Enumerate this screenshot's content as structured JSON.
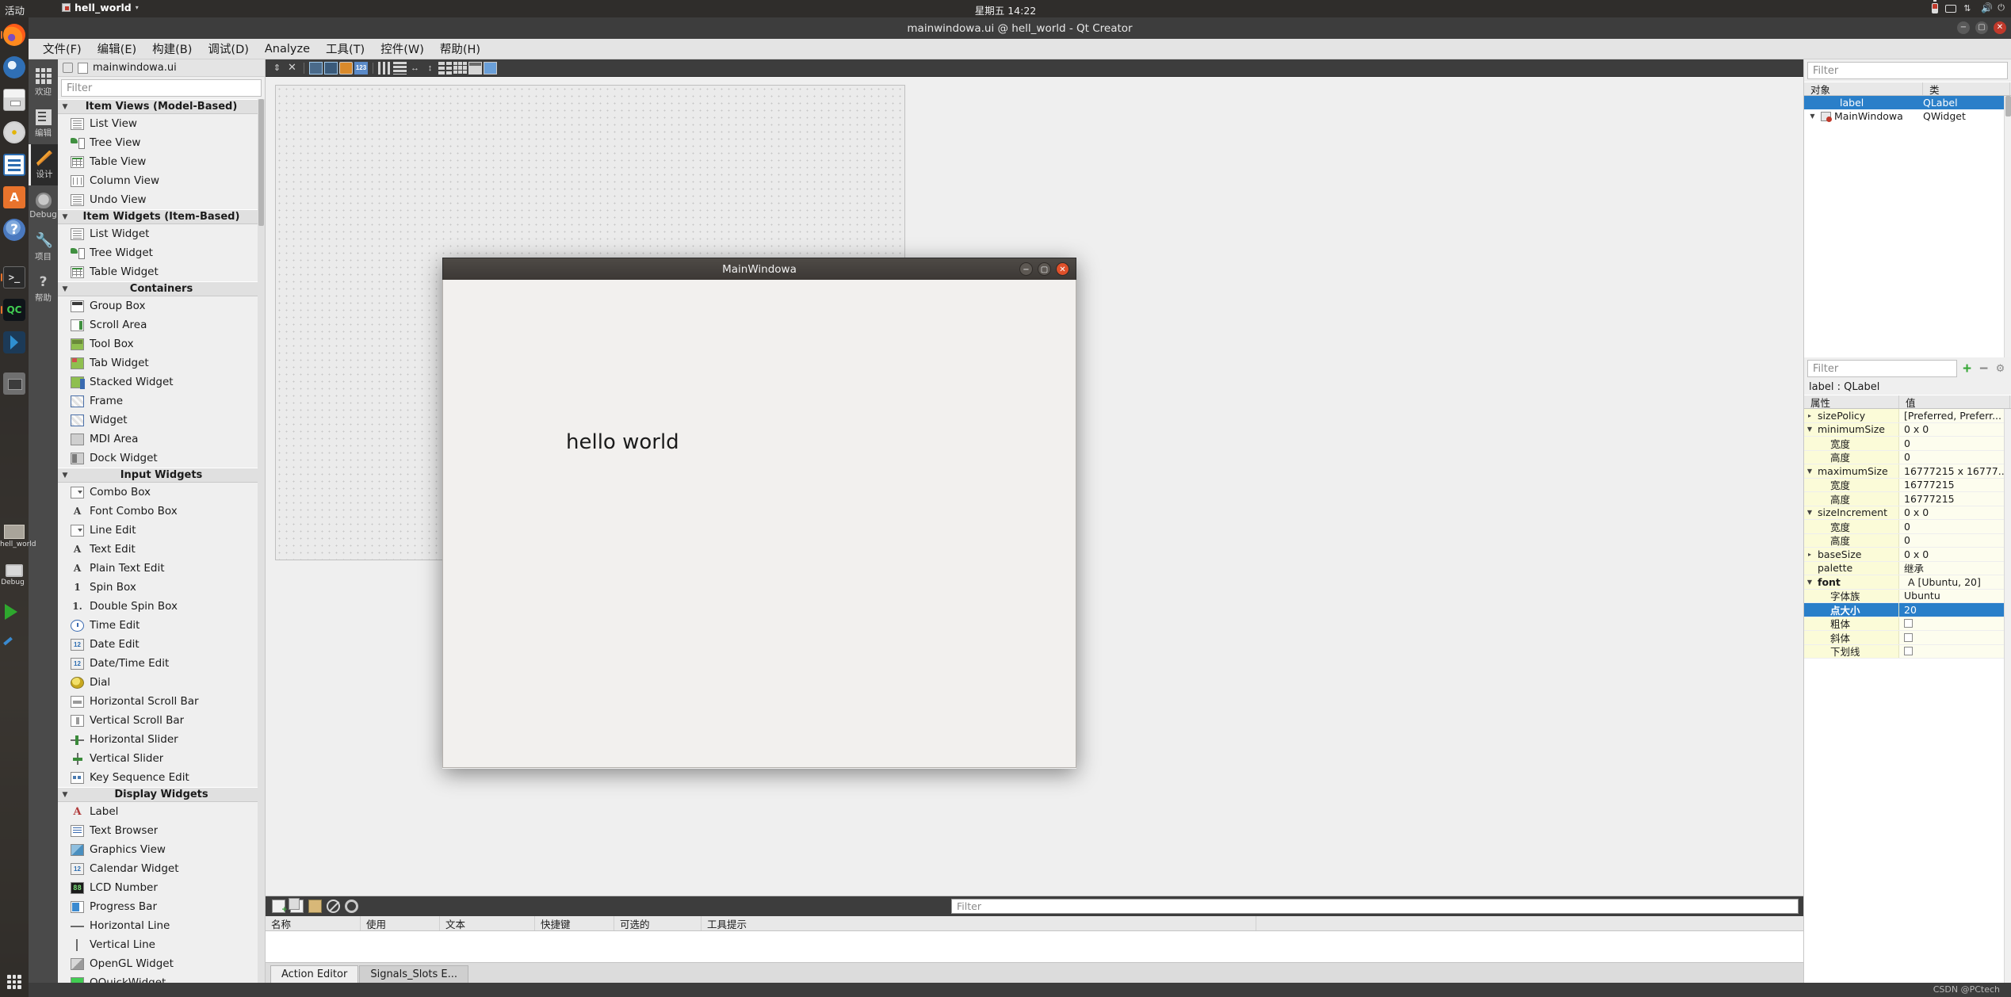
{
  "desktop": {
    "topbar": {
      "activities": "活动",
      "app_name": "hell_world",
      "clock": "星期五 14:22",
      "tray_icons": [
        "battery-icon",
        "keyboard-icon",
        "network-icon",
        "volume-icon",
        "power-icon"
      ]
    },
    "dock": {
      "items": [
        {
          "name": "firefox",
          "icon": "firefox-icon"
        },
        {
          "name": "thunderbird",
          "icon": "thunderbird-icon"
        },
        {
          "name": "files",
          "icon": "files-icon"
        },
        {
          "name": "rhythmbox",
          "icon": "rhythmbox-icon"
        },
        {
          "name": "libreoffice-writer",
          "icon": "writer-icon"
        },
        {
          "name": "ubuntu-software",
          "icon": "software-icon",
          "glyph": "A"
        },
        {
          "name": "help",
          "icon": "help-icon",
          "glyph": "?"
        },
        {
          "name": "terminal",
          "icon": "terminal-icon",
          "glyph": ">_"
        },
        {
          "name": "qt-creator",
          "icon": "qt-creator-icon",
          "glyph": "QC"
        },
        {
          "name": "vs-code",
          "icon": "vscode-icon"
        },
        {
          "name": "folder",
          "icon": "folder-icon"
        }
      ],
      "folder_label": "hell_world",
      "debug_label": "Debug",
      "show_apps": "show-applications-icon"
    }
  },
  "window": {
    "title": "mainwindowa.ui @ hell_world - Qt Creator",
    "menu": [
      {
        "label": "文件(F)",
        "name": "menu-file"
      },
      {
        "label": "编辑(E)",
        "name": "menu-edit"
      },
      {
        "label": "构建(B)",
        "name": "menu-build"
      },
      {
        "label": "调试(D)",
        "name": "menu-debug"
      },
      {
        "label": "Analyze",
        "name": "menu-analyze"
      },
      {
        "label": "工具(T)",
        "name": "menu-tools"
      },
      {
        "label": "控件(W)",
        "name": "menu-widgets"
      },
      {
        "label": "帮助(H)",
        "name": "menu-help"
      }
    ]
  },
  "modebar": {
    "items": [
      {
        "label": "欢迎",
        "icon": "grid-icon",
        "active": false
      },
      {
        "label": "编辑",
        "icon": "document-icon",
        "active": false
      },
      {
        "label": "设计",
        "icon": "pencil-icon",
        "active": true
      },
      {
        "label": "Debug",
        "icon": "bug-icon",
        "active": false
      },
      {
        "label": "项目",
        "icon": "wrench-icon",
        "active": false
      },
      {
        "label": "帮助",
        "icon": "question-icon",
        "active": false
      }
    ]
  },
  "editor_bar": {
    "file_label": "mainwindowa.ui",
    "lock_icon": "unlock-icon",
    "file_icon": "ui-file-icon"
  },
  "widget_box": {
    "filter_placeholder": "Filter",
    "groups": [
      {
        "title": "Item Views (Model-Based)",
        "items": [
          {
            "label": "List View",
            "icon": "list-view-icon"
          },
          {
            "label": "Tree View",
            "icon": "tree-view-icon"
          },
          {
            "label": "Table View",
            "icon": "table-view-icon"
          },
          {
            "label": "Column View",
            "icon": "column-view-icon"
          },
          {
            "label": "Undo View",
            "icon": "undo-view-icon"
          }
        ]
      },
      {
        "title": "Item Widgets (Item-Based)",
        "items": [
          {
            "label": "List Widget",
            "icon": "list-widget-icon"
          },
          {
            "label": "Tree Widget",
            "icon": "tree-widget-icon"
          },
          {
            "label": "Table Widget",
            "icon": "table-widget-icon"
          }
        ]
      },
      {
        "title": "Containers",
        "items": [
          {
            "label": "Group Box",
            "icon": "group-box-icon"
          },
          {
            "label": "Scroll Area",
            "icon": "scroll-area-icon"
          },
          {
            "label": "Tool Box",
            "icon": "tool-box-icon"
          },
          {
            "label": "Tab Widget",
            "icon": "tab-widget-icon"
          },
          {
            "label": "Stacked Widget",
            "icon": "stacked-widget-icon"
          },
          {
            "label": "Frame",
            "icon": "frame-icon"
          },
          {
            "label": "Widget",
            "icon": "widget-icon"
          },
          {
            "label": "MDI Area",
            "icon": "mdi-area-icon"
          },
          {
            "label": "Dock Widget",
            "icon": "dock-widget-icon"
          }
        ]
      },
      {
        "title": "Input Widgets",
        "items": [
          {
            "label": "Combo Box",
            "icon": "combo-box-icon"
          },
          {
            "label": "Font Combo Box",
            "icon": "font-combo-box-icon"
          },
          {
            "label": "Line Edit",
            "icon": "line-edit-icon"
          },
          {
            "label": "Text Edit",
            "icon": "text-edit-icon"
          },
          {
            "label": "Plain Text Edit",
            "icon": "plain-text-edit-icon"
          },
          {
            "label": "Spin Box",
            "icon": "spin-box-icon"
          },
          {
            "label": "Double Spin Box",
            "icon": "double-spin-box-icon"
          },
          {
            "label": "Time Edit",
            "icon": "time-edit-icon"
          },
          {
            "label": "Date Edit",
            "icon": "date-edit-icon"
          },
          {
            "label": "Date/Time Edit",
            "icon": "datetime-edit-icon"
          },
          {
            "label": "Dial",
            "icon": "dial-icon"
          },
          {
            "label": "Horizontal Scroll Bar",
            "icon": "h-scrollbar-icon"
          },
          {
            "label": "Vertical Scroll Bar",
            "icon": "v-scrollbar-icon"
          },
          {
            "label": "Horizontal Slider",
            "icon": "h-slider-icon"
          },
          {
            "label": "Vertical Slider",
            "icon": "v-slider-icon"
          },
          {
            "label": "Key Sequence Edit",
            "icon": "key-sequence-icon"
          }
        ]
      },
      {
        "title": "Display Widgets",
        "items": [
          {
            "label": "Label",
            "icon": "label-icon"
          },
          {
            "label": "Text Browser",
            "icon": "text-browser-icon"
          },
          {
            "label": "Graphics View",
            "icon": "graphics-view-icon"
          },
          {
            "label": "Calendar Widget",
            "icon": "calendar-widget-icon"
          },
          {
            "label": "LCD Number",
            "icon": "lcd-number-icon"
          },
          {
            "label": "Progress Bar",
            "icon": "progress-bar-icon"
          },
          {
            "label": "Horizontal Line",
            "icon": "h-line-icon"
          },
          {
            "label": "Vertical Line",
            "icon": "v-line-icon"
          },
          {
            "label": "OpenGL Widget",
            "icon": "opengl-widget-icon"
          },
          {
            "label": "QQuickWidget",
            "icon": "qquickwidget-icon"
          }
        ]
      }
    ]
  },
  "designer_toolbar": {
    "buttons": [
      {
        "name": "edit-widgets-icon"
      },
      {
        "name": "delete-icon"
      },
      {
        "name": "edit-signals-slots-icon"
      },
      {
        "name": "edit-buddies-icon"
      },
      {
        "name": "edit-tab-order-icon"
      },
      {
        "name": "layout-horizontally-icon"
      },
      {
        "name": "layout-vertically-icon"
      },
      {
        "name": "layout-splitter-h-icon"
      },
      {
        "name": "layout-splitter-v-icon"
      },
      {
        "name": "layout-form-icon"
      },
      {
        "name": "layout-grid-icon"
      },
      {
        "name": "break-layout-icon"
      },
      {
        "name": "adjust-size-icon"
      }
    ]
  },
  "action_editor": {
    "toolbar_icons": [
      "new-action-icon",
      "copy-icon",
      "paste-icon",
      "delete-icon",
      "configure-icon"
    ],
    "filter_placeholder": "Filter",
    "columns": [
      "名称",
      "使用",
      "文本",
      "快捷键",
      "可选的",
      "工具提示"
    ],
    "rows": [],
    "tabs": [
      {
        "label": "Action Editor",
        "active": true
      },
      {
        "label": "Signals_Slots E...",
        "active": false
      }
    ]
  },
  "object_inspector": {
    "filter_placeholder": "Filter",
    "columns": [
      "对象",
      "类"
    ],
    "rows": [
      {
        "object": "MainWindowa",
        "class": "QWidget",
        "depth": 0,
        "selected": false,
        "expander": "▼"
      },
      {
        "object": "label",
        "class": "QLabel",
        "depth": 1,
        "selected": true,
        "expander": ""
      }
    ]
  },
  "property_editor": {
    "filter_placeholder": "Filter",
    "buttons": [
      "add-icon",
      "remove-icon",
      "configure-icon"
    ],
    "object_header": "label : QLabel",
    "columns": [
      "属性",
      "值"
    ],
    "rows": [
      {
        "key": "sizePolicy",
        "value": "[Preferred, Preferr...",
        "tri": "▸",
        "indent": 0,
        "selected": false
      },
      {
        "key": "minimumSize",
        "value": "0 x 0",
        "tri": "▼",
        "indent": 0,
        "selected": false
      },
      {
        "key": "宽度",
        "value": "0",
        "tri": "",
        "indent": 1,
        "selected": false
      },
      {
        "key": "高度",
        "value": "0",
        "tri": "",
        "indent": 1,
        "selected": false
      },
      {
        "key": "maximumSize",
        "value": "16777215 x 16777...",
        "tri": "▼",
        "indent": 0,
        "selected": false
      },
      {
        "key": "宽度",
        "value": "16777215",
        "tri": "",
        "indent": 1,
        "selected": false
      },
      {
        "key": "高度",
        "value": "16777215",
        "tri": "",
        "indent": 1,
        "selected": false
      },
      {
        "key": "sizeIncrement",
        "value": "0 x 0",
        "tri": "▼",
        "indent": 0,
        "selected": false
      },
      {
        "key": "宽度",
        "value": "0",
        "tri": "",
        "indent": 1,
        "selected": false
      },
      {
        "key": "高度",
        "value": "0",
        "tri": "",
        "indent": 1,
        "selected": false
      },
      {
        "key": "baseSize",
        "value": "0 x 0",
        "tri": "▸",
        "indent": 0,
        "selected": false
      },
      {
        "key": "palette",
        "value": "继承",
        "tri": "",
        "indent": 0,
        "selected": false
      },
      {
        "key": "font",
        "value": "A  [Ubuntu, 20]",
        "tri": "▼",
        "indent": 0,
        "selected": false,
        "bold": true
      },
      {
        "key": "字体族",
        "value": "Ubuntu",
        "tri": "",
        "indent": 1,
        "selected": false
      },
      {
        "key": "点大小",
        "value": "20",
        "tri": "",
        "indent": 1,
        "selected": true
      },
      {
        "key": "粗体",
        "value": "",
        "tri": "",
        "indent": 1,
        "selected": false,
        "checkbox": true
      },
      {
        "key": "斜体",
        "value": "",
        "tri": "",
        "indent": 1,
        "selected": false,
        "checkbox": true
      },
      {
        "key": "下划线",
        "value": "",
        "tri": "",
        "indent": 1,
        "selected": false,
        "checkbox": true
      }
    ]
  },
  "preview": {
    "title": "MainWindowa",
    "label_text": "hello world",
    "window_buttons": [
      "minimize-icon",
      "maximize-icon",
      "close-icon"
    ]
  },
  "watermark": "CSDN @PCtech",
  "colors": {
    "accent": "#2a7fc9",
    "property_bg": "#fdfdee",
    "toolbar_dark": "#3d3d3d",
    "ubuntu_orange": "#e8732c"
  }
}
